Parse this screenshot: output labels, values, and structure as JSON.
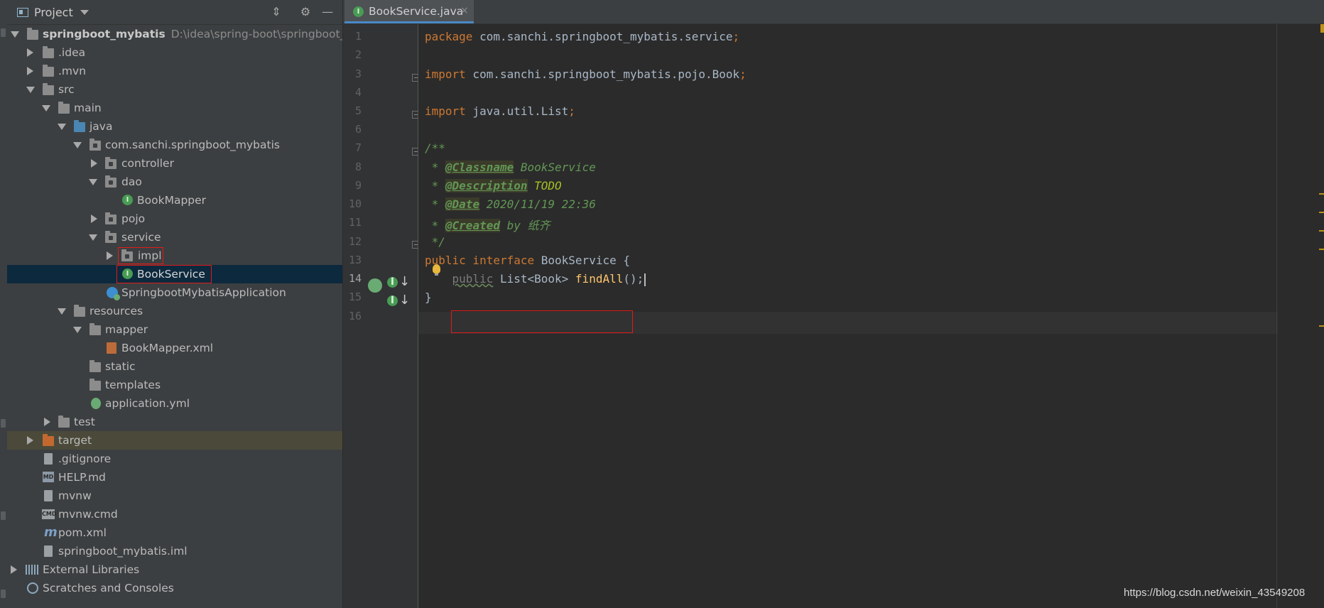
{
  "project_panel": {
    "title": "Project",
    "tree": [
      {
        "label": "springboot_mybatis",
        "path": "D:\\idea\\spring-boot\\springboot_myb"
      },
      {
        "label": ".idea"
      },
      {
        "label": ".mvn"
      },
      {
        "label": "src"
      },
      {
        "label": "main"
      },
      {
        "label": "java"
      },
      {
        "label": "com.sanchi.springboot_mybatis"
      },
      {
        "label": "controller"
      },
      {
        "label": "dao"
      },
      {
        "label": "BookMapper"
      },
      {
        "label": "pojo"
      },
      {
        "label": "service"
      },
      {
        "label": "impl"
      },
      {
        "label": "BookService"
      },
      {
        "label": "SpringbootMybatisApplication"
      },
      {
        "label": "resources"
      },
      {
        "label": "mapper"
      },
      {
        "label": "BookMapper.xml"
      },
      {
        "label": "static"
      },
      {
        "label": "templates"
      },
      {
        "label": "application.yml"
      },
      {
        "label": "test"
      },
      {
        "label": "target"
      },
      {
        "label": ".gitignore"
      },
      {
        "label": "HELP.md"
      },
      {
        "label": "mvnw"
      },
      {
        "label": "mvnw.cmd"
      },
      {
        "label": "pom.xml"
      },
      {
        "label": "springboot_mybatis.iml"
      },
      {
        "label": "External Libraries"
      },
      {
        "label": "Scratches and Consoles"
      }
    ]
  },
  "editor": {
    "tab_label": "BookService.java",
    "tab_close": "×",
    "line_numbers": [
      "1",
      "2",
      "3",
      "4",
      "5",
      "6",
      "7",
      "8",
      "9",
      "10",
      "11",
      "12",
      "13",
      "14",
      "15",
      "16"
    ],
    "code": {
      "l1_kw": "package",
      "l1_rest": " com.sanchi.springboot_mybatis.service",
      "l3_kw": "import",
      "l3_rest": " com.sanchi.springboot_mybatis.pojo.Book",
      "l5_kw": "import",
      "l5_rest": " java.util.List",
      "semi": ";",
      "l7": "/**",
      "l8_star": " * ",
      "l8_tag": "@Classname",
      "l8_rest": " BookService",
      "l9_star": " * ",
      "l9_tag": "@Description",
      "l9_rest": " TODO",
      "l10_star": " * ",
      "l10_tag": "@Date",
      "l10_rest": " 2020/11/19 22:36",
      "l11_star": " * ",
      "l11_tag": "@Created",
      "l11_rest": " by 纸齐",
      "l12": " */",
      "l13_kw": "public interface",
      "l13_rest": " BookService {",
      "l14_kw": "public",
      "l14_type": " List<Book> ",
      "l14_fn": "findAll",
      "l14_end": "();",
      "l15": "}"
    }
  },
  "watermark": "https://blog.csdn.net/weixin_43549208",
  "colors": {
    "panel_bg": "#3c3f41",
    "editor_bg": "#2b2b2b",
    "selection": "#0d293e",
    "keyword": "#cc7832",
    "doc_comment": "#629755",
    "function": "#ffc66d",
    "highlight_box": "#e21a1a"
  }
}
